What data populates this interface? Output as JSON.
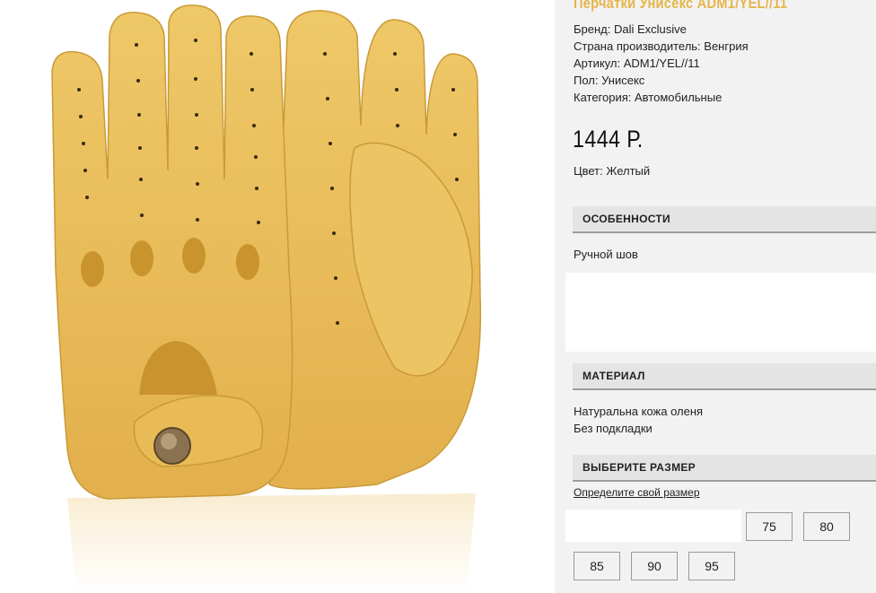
{
  "product": {
    "title": "Перчатки Унисекс ADM1/YEL//11",
    "specs": [
      "Бренд: Dali Exclusive",
      "Страна производитель: Венгрия",
      "Артикул: ADM1/YEL//11",
      "Пол: Унисекс",
      "Категория: Автомобильные"
    ],
    "price": "1444 Р.",
    "color_line": "Цвет: Желтый",
    "image": {
      "description_icon": "glove-product-image",
      "main_color": "#e9bd5c"
    }
  },
  "features": {
    "header": "ОСОБЕННОСТИ",
    "text": "Ручной шов"
  },
  "material": {
    "header": "МАТЕРИАЛ",
    "lines": [
      "Натуральна кожа оленя",
      "Без подкладки"
    ]
  },
  "sizes": {
    "header": "ВЫБЕРИТЕ РАЗМЕР",
    "link": "Определите свой размер",
    "options": [
      "75",
      "80",
      "85",
      "90",
      "95"
    ]
  },
  "colors": {
    "accent": "#e5b54a",
    "panel": "#f2f2f2",
    "header_bg": "#e4e4e4"
  }
}
